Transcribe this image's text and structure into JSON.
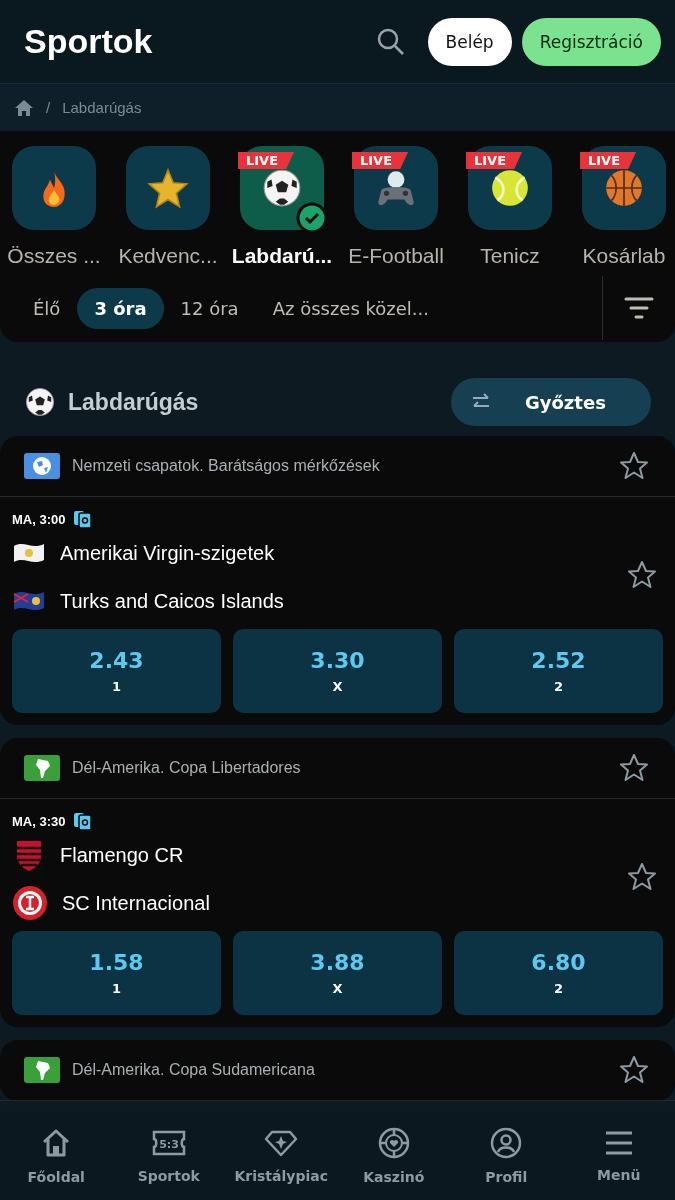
{
  "header": {
    "title": "Sportok",
    "login": "Belép",
    "register": "Regisztráció"
  },
  "breadcrumb": {
    "separator": "/",
    "items": [
      "Labdarúgás"
    ]
  },
  "sports": [
    {
      "label": "Összes ...",
      "live": false,
      "selected": false
    },
    {
      "label": "Kedvenc...",
      "live": false,
      "selected": false
    },
    {
      "label": "Labdarú...",
      "live": true,
      "live_label": "LIVE",
      "selected": true
    },
    {
      "label": "E-Football",
      "live": true,
      "live_label": "LIVE",
      "selected": false
    },
    {
      "label": "Tenicz",
      "live": true,
      "live_label": "LIVE",
      "selected": false
    },
    {
      "label": "Kosárlab",
      "live": true,
      "live_label": "LIVE",
      "selected": false
    }
  ],
  "time_filters": [
    {
      "label": "Élő",
      "selected": false
    },
    {
      "label": "3 óra",
      "selected": true
    },
    {
      "label": "12 óra",
      "selected": false
    },
    {
      "label": "Az összes közel...",
      "selected": false
    }
  ],
  "section": {
    "title": "Labdarúgás",
    "market": "Győztes"
  },
  "leagues": [
    {
      "name": "Nemzeti csapatok. Barátságos mérkőzések",
      "favorite": false,
      "matches": [
        {
          "time": "MA, 3:00",
          "teams": [
            {
              "name": "Amerikai Virgin-szigetek"
            },
            {
              "name": "Turks and Caicos Islands"
            }
          ],
          "favorite": false,
          "odds": [
            {
              "value": "2.43",
              "label": "1"
            },
            {
              "value": "3.30",
              "label": "X"
            },
            {
              "value": "2.52",
              "label": "2"
            }
          ]
        }
      ]
    },
    {
      "name": "Dél-Amerika. Copa Libertadores",
      "favorite": false,
      "matches": [
        {
          "time": "MA, 3:30",
          "teams": [
            {
              "name": "Flamengo CR"
            },
            {
              "name": "SC Internacional"
            }
          ],
          "favorite": false,
          "odds": [
            {
              "value": "1.58",
              "label": "1"
            },
            {
              "value": "3.88",
              "label": "X"
            },
            {
              "value": "6.80",
              "label": "2"
            }
          ]
        }
      ]
    },
    {
      "name": "Dél-Amerika. Copa Sudamericana",
      "favorite": false
    }
  ],
  "nav": [
    {
      "label": "Főoldal"
    },
    {
      "label": "Sportok",
      "icon_text": "5:3"
    },
    {
      "label": "Kristálypiac"
    },
    {
      "label": "Kaszinó"
    },
    {
      "label": "Profil"
    },
    {
      "label": "Menü"
    }
  ]
}
